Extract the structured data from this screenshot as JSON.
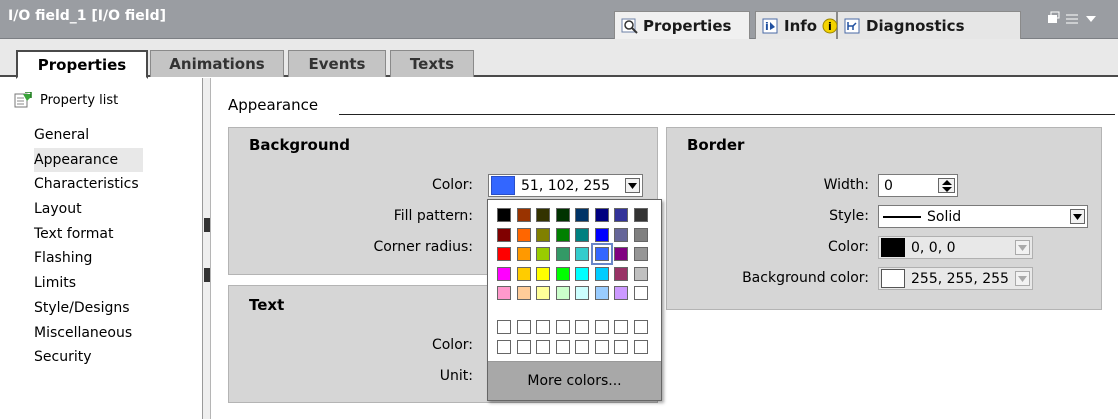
{
  "window": {
    "title": "I/O field_1 [I/O field]",
    "top_tabs": [
      "Properties",
      "Info",
      "Diagnostics"
    ]
  },
  "tabs": [
    "Properties",
    "Animations",
    "Events",
    "Texts"
  ],
  "nav": {
    "property_list": "Property list",
    "items": [
      "General",
      "Appearance",
      "Characteristics",
      "Layout",
      "Text format",
      "Flashing",
      "Limits",
      "Style/Designs",
      "Miscellaneous",
      "Security"
    ],
    "selected": "Appearance"
  },
  "appearance": {
    "heading": "Appearance",
    "background": {
      "title": "Background",
      "color_label": "Color:",
      "color_value": "51, 102, 255",
      "color_hex": "#3366ff",
      "fill_pattern_label": "Fill pattern:",
      "corner_radius_label": "Corner radius:"
    },
    "text": {
      "title": "Text",
      "color_label": "Color:",
      "unit_label": "Unit:"
    },
    "border": {
      "title": "Border",
      "width_label": "Width:",
      "width_value": "0",
      "style_label": "Style:",
      "style_value": "Solid",
      "color_label": "Color:",
      "color_value": "0, 0, 0",
      "color_hex": "#000000",
      "bg_color_label": "Background color:",
      "bg_color_value": "255, 255, 255",
      "bg_color_hex": "#ffffff"
    }
  },
  "color_picker": {
    "rows": [
      [
        "#000000",
        "#993300",
        "#333300",
        "#003300",
        "#003366",
        "#000080",
        "#333399",
        "#333333"
      ],
      [
        "#800000",
        "#ff6600",
        "#808000",
        "#008000",
        "#008080",
        "#0000ff",
        "#666699",
        "#808080"
      ],
      [
        "#ff0000",
        "#ff9900",
        "#99cc00",
        "#339966",
        "#33cccc",
        "#3366ff",
        "#800080",
        "#969696"
      ],
      [
        "#ff00ff",
        "#ffcc00",
        "#ffff00",
        "#00ff00",
        "#00ffff",
        "#00ccff",
        "#993366",
        "#c0c0c0"
      ],
      [
        "#ff99cc",
        "#ffcc99",
        "#ffff99",
        "#ccffcc",
        "#ccffff",
        "#99ccff",
        "#cc99ff",
        "#ffffff"
      ]
    ],
    "custom_rows": [
      [
        "#ffffff",
        "#ffffff",
        "#ffffff",
        "#ffffff",
        "#ffffff",
        "#ffffff",
        "#ffffff",
        "#ffffff"
      ],
      [
        "#ffffff",
        "#ffffff",
        "#ffffff",
        "#ffffff",
        "#ffffff",
        "#ffffff",
        "#ffffff",
        "#ffffff"
      ]
    ],
    "selected": "#3366ff",
    "more_colors": "More colors..."
  },
  "icons": [
    "properties-icon",
    "info-icon",
    "warning-info-icon",
    "diagnostics-icon",
    "property-list-icon",
    "dropdown-arrow-icon",
    "spin-icon",
    "line-style-icon"
  ]
}
